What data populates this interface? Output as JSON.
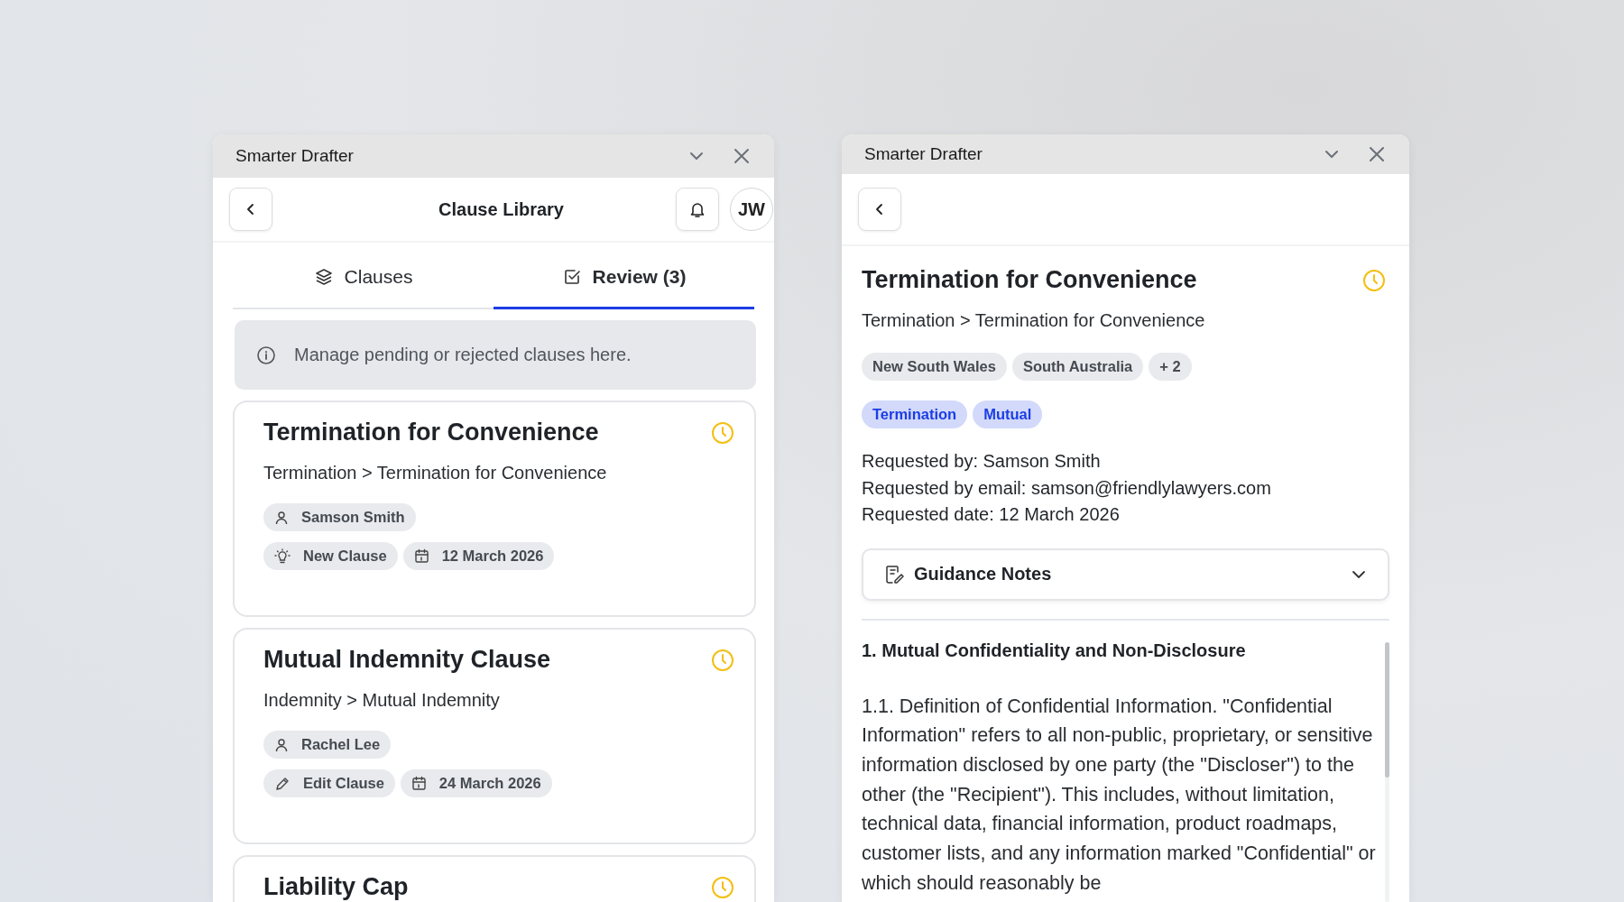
{
  "left_panel": {
    "window_title": "Smarter Drafter",
    "header": {
      "title": "Clause Library",
      "avatar": "JW"
    },
    "tabs": [
      {
        "label": "Clauses",
        "selected": false
      },
      {
        "label": "Review (3)",
        "selected": true
      }
    ],
    "info": "Manage pending or rejected clauses here.",
    "cards": [
      {
        "title": "Termination for Convenience",
        "breadcrumb": "Termination > Termination for Convenience",
        "requester": "Samson Smith",
        "change": {
          "kind": "new",
          "label": "New Clause"
        },
        "date": "12 March 2026"
      },
      {
        "title": "Mutual Indemnity Clause",
        "breadcrumb": "Indemnity > Mutual Indemnity",
        "requester": "Rachel Lee",
        "change": {
          "kind": "edit",
          "label": "Edit Clause"
        },
        "date": "24 March 2026"
      },
      {
        "title": "Liability Cap"
      }
    ]
  },
  "right_panel": {
    "window_title": "Smarter Drafter",
    "title": "Termination for Convenience",
    "breadcrumb": "Termination > Termination for Convenience",
    "jurisdictions": [
      "New South Wales",
      "South Australia",
      "+ 2"
    ],
    "tags": [
      "Termination",
      "Mutual"
    ],
    "details": [
      "Requested by: Samson Smith",
      "Requested by email: samson@friendlylawyers.com",
      "Requested date: 12 March 2026"
    ],
    "guidance": {
      "label": "Guidance Notes",
      "expanded": false
    },
    "clause": {
      "heading": "1. Mutual Confidentiality and Non-Disclosure",
      "paragraph": "1.1. Definition of Confidential Information. \"Confidential Information\" refers to all non-public, proprietary, or sensitive information disclosed by one party (the \"Discloser\") to the other (the \"Recipient\"). This includes, without limitation, technical data, financial information, product roadmaps, customer lists, and any information marked \"Confidential\" or which should reasonably be"
    }
  }
}
